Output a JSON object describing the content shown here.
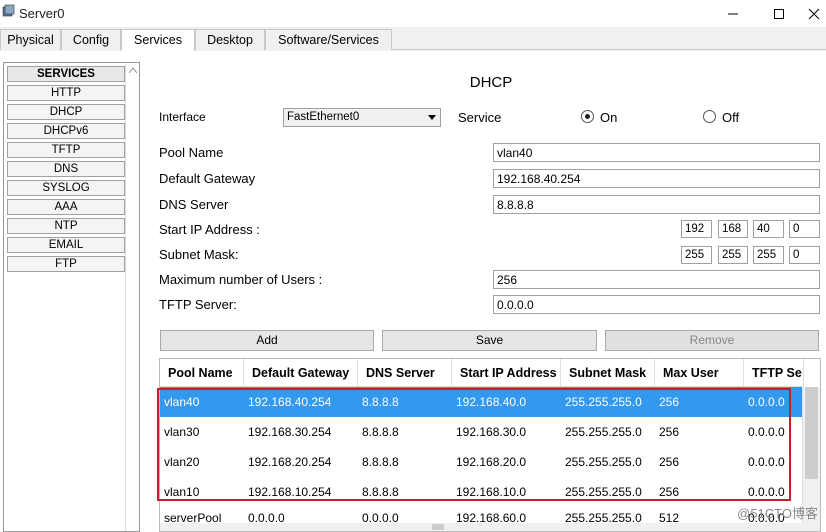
{
  "window": {
    "title": "Server0"
  },
  "tabs": [
    "Physical",
    "Config",
    "Services",
    "Desktop",
    "Software/Services"
  ],
  "services_panel": {
    "header": "SERVICES",
    "items": [
      "HTTP",
      "DHCP",
      "DHCPv6",
      "TFTP",
      "DNS",
      "SYSLOG",
      "AAA",
      "NTP",
      "EMAIL",
      "FTP"
    ]
  },
  "dhcp": {
    "title": "DHCP",
    "interface_label": "Interface",
    "interface_value": "FastEthernet0",
    "service_label": "Service",
    "on_label": "On",
    "off_label": "Off",
    "pool_name_label": "Pool Name",
    "pool_name_value": "vlan40",
    "gateway_label": "Default Gateway",
    "gateway_value": "192.168.40.254",
    "dns_label": "DNS Server",
    "dns_value": "8.8.8.8",
    "start_ip_label": "Start IP Address :",
    "start_ip": [
      "192",
      "168",
      "40",
      "0"
    ],
    "mask_label": "Subnet Mask:",
    "mask": [
      "255",
      "255",
      "255",
      "0"
    ],
    "max_users_label": "Maximum number of Users :",
    "max_users_value": "256",
    "tftp_label": "TFTP Server:",
    "tftp_value": "0.0.0.0",
    "add_label": "Add",
    "save_label": "Save",
    "remove_label": "Remove"
  },
  "table": {
    "headers": [
      "Pool Name",
      "Default Gateway",
      "DNS Server",
      "Start IP Address",
      "Subnet Mask",
      "Max User",
      "TFTP Se"
    ],
    "rows": [
      [
        "vlan40",
        "192.168.40.254",
        "8.8.8.8",
        "192.168.40.0",
        "255.255.255.0",
        "256",
        "0.0.0.0"
      ],
      [
        "vlan30",
        "192.168.30.254",
        "8.8.8.8",
        "192.168.30.0",
        "255.255.255.0",
        "256",
        "0.0.0.0"
      ],
      [
        "vlan20",
        "192.168.20.254",
        "8.8.8.8",
        "192.168.20.0",
        "255.255.255.0",
        "256",
        "0.0.0.0"
      ],
      [
        "vlan10",
        "192.168.10.254",
        "8.8.8.8",
        "192.168.10.0",
        "255.255.255.0",
        "256",
        "0.0.0.0"
      ],
      [
        "serverPool",
        "0.0.0.0",
        "0.0.0.0",
        "192.168.60.0",
        "255.255.255.0",
        "512",
        "0.0.0.0"
      ]
    ]
  },
  "watermark": "@51CTO博客",
  "colors": {
    "selected_row": "#3399ee",
    "highlight_box": "#c0202a"
  }
}
